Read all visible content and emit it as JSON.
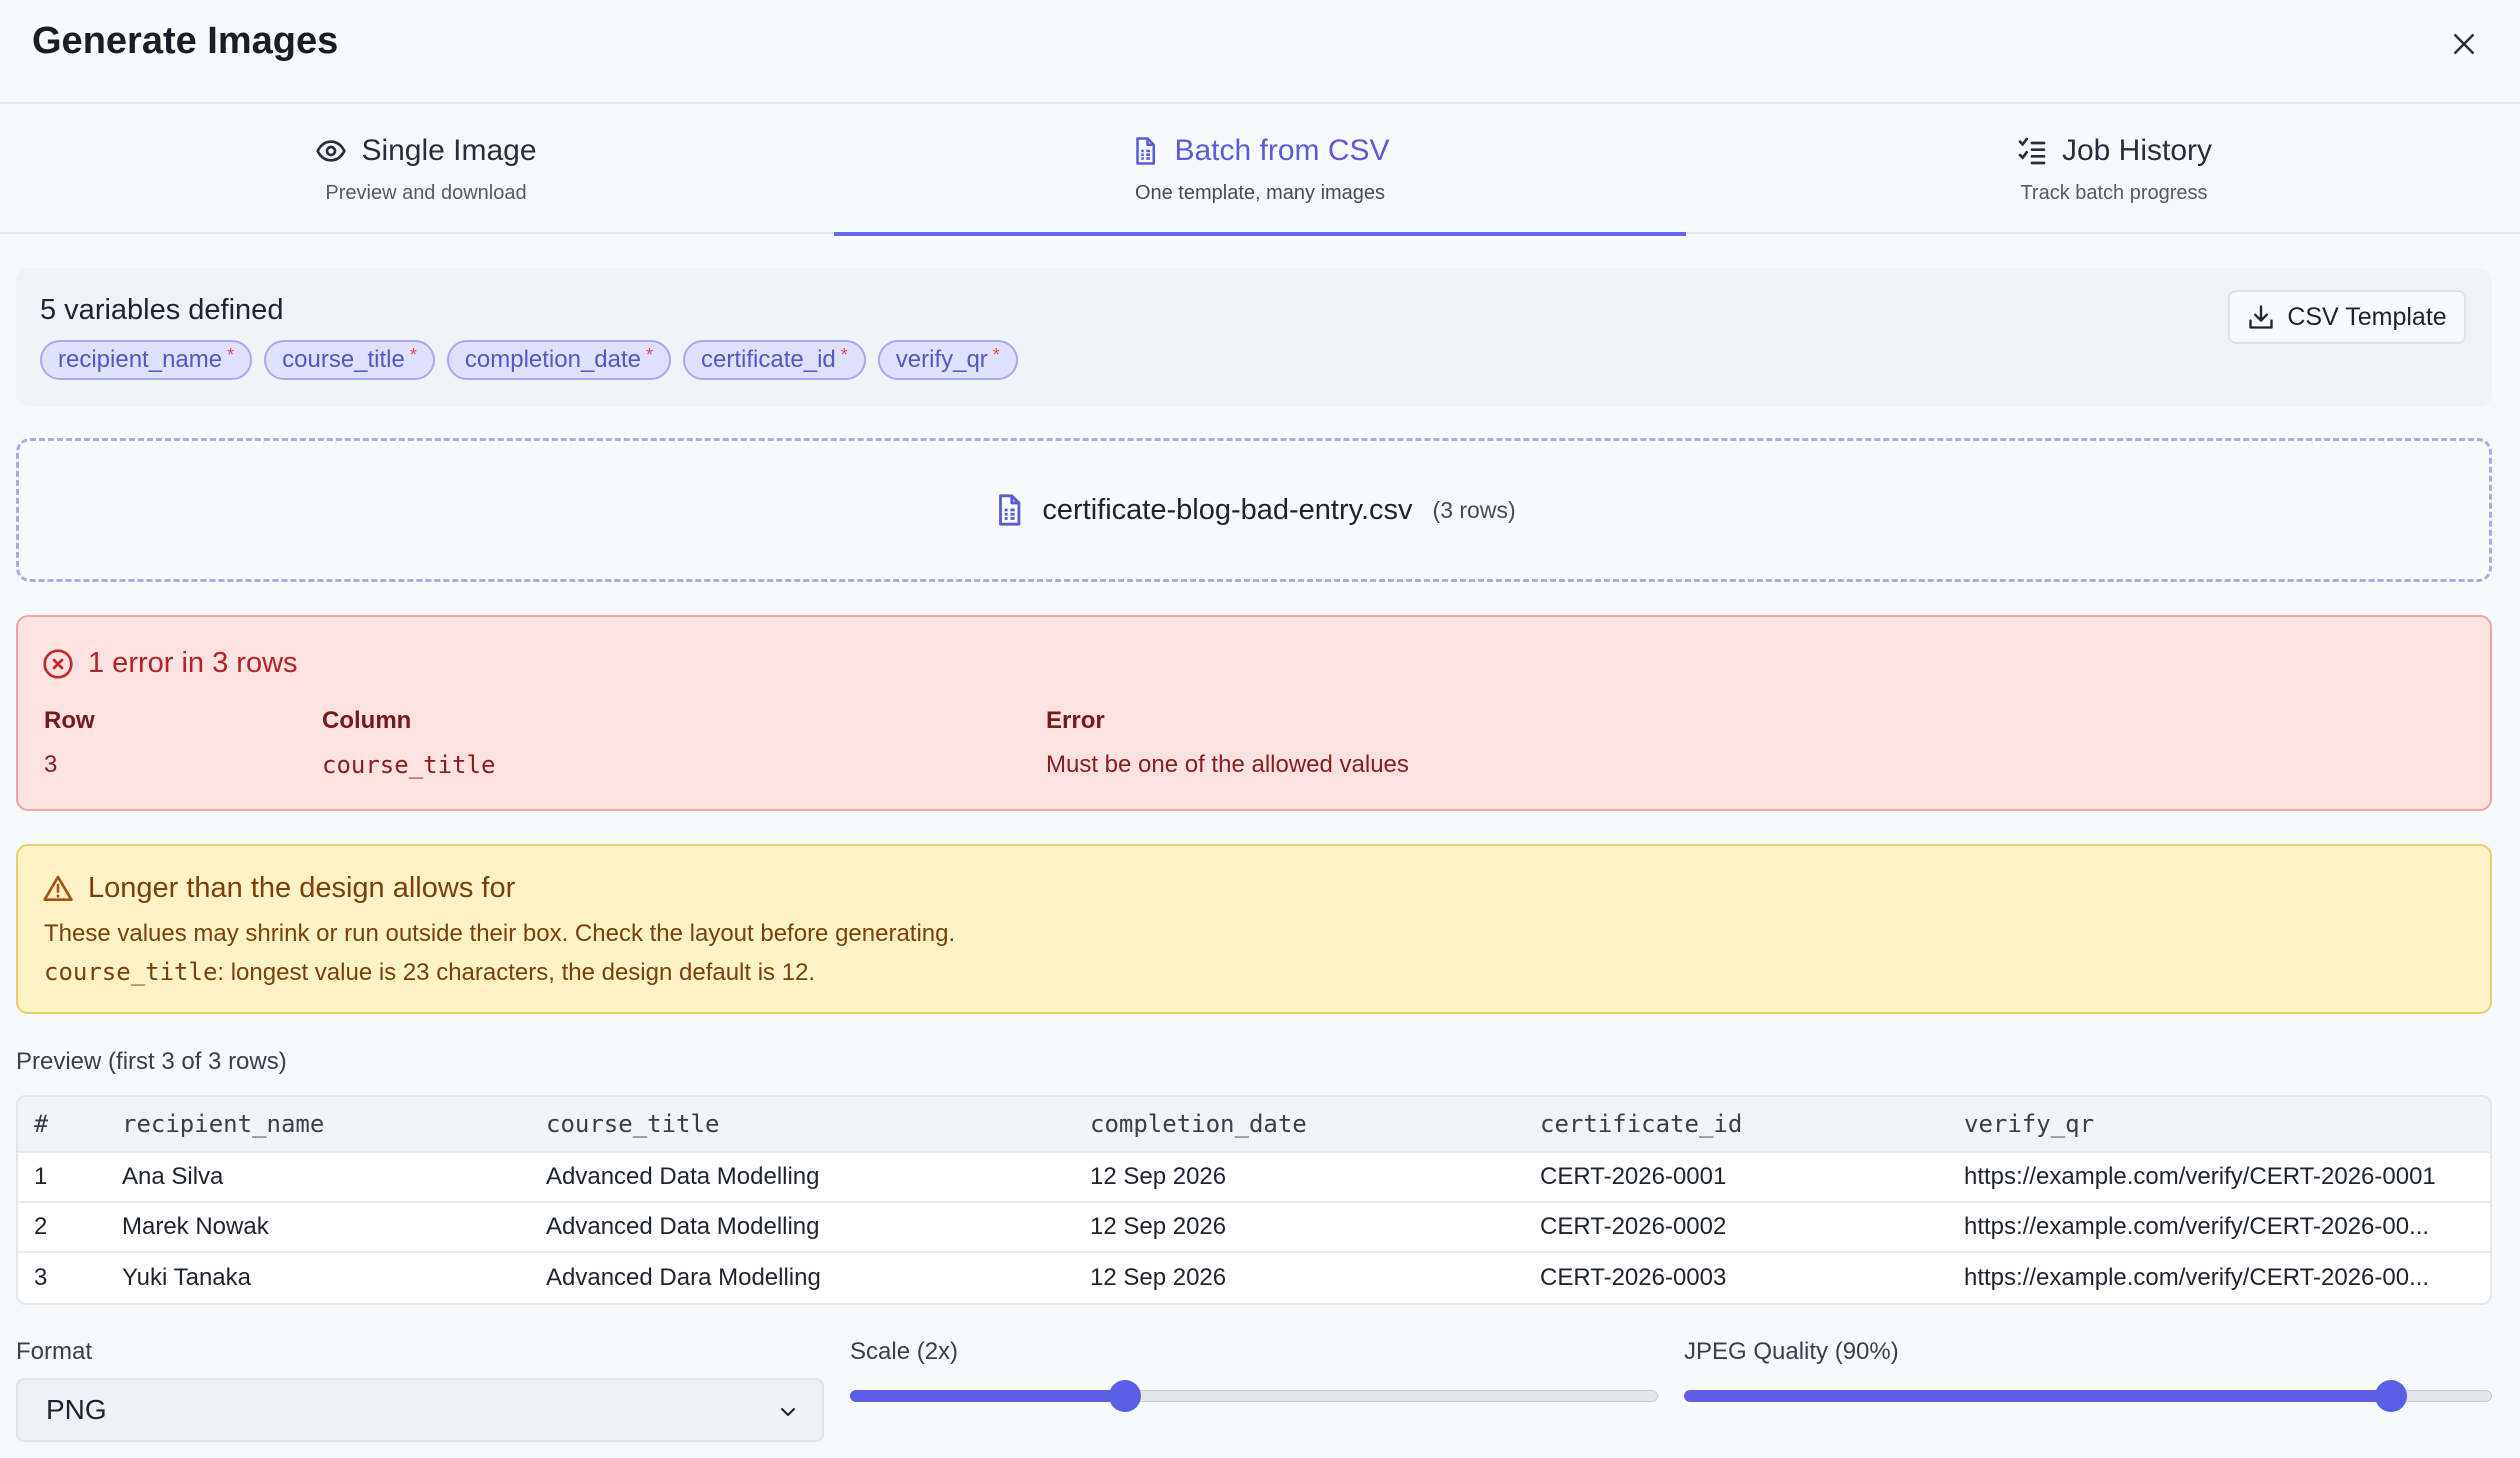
{
  "header": {
    "title": "Generate Images"
  },
  "tabs": [
    {
      "label": "Single Image",
      "sub": "Preview and download",
      "icon": "eye-icon"
    },
    {
      "label": "Batch from CSV",
      "sub": "One template, many images",
      "icon": "file-spreadsheet-icon",
      "active": true
    },
    {
      "label": "Job History",
      "sub": "Track batch progress",
      "icon": "list-checks-icon"
    }
  ],
  "variables": {
    "title": "5 variables defined",
    "chips": [
      "recipient_name",
      "course_title",
      "completion_date",
      "certificate_id",
      "verify_qr"
    ],
    "required_mark": "*",
    "csv_template_label": "CSV Template"
  },
  "upload": {
    "filename": "certificate-blog-bad-entry.csv",
    "rows": "(3 rows)"
  },
  "errors": {
    "title": "1 error in 3 rows",
    "headers": {
      "row": "Row",
      "column": "Column",
      "error": "Error"
    },
    "items": [
      {
        "row": "3",
        "column": "course_title",
        "error": "Must be one of the allowed values"
      }
    ]
  },
  "warning": {
    "title": "Longer than the design allows for",
    "line1": "These values may shrink or run outside their box. Check the layout before generating.",
    "field": "course_title",
    "line2_rest": ": longest value is 23 characters, the design default is 12."
  },
  "preview": {
    "label": "Preview (first 3 of 3 rows)",
    "columns": [
      "#",
      "recipient_name",
      "course_title",
      "completion_date",
      "certificate_id",
      "verify_qr"
    ],
    "rows": [
      [
        "1",
        "Ana Silva",
        "Advanced Data Modelling",
        "12 Sep 2026",
        "CERT-2026-0001",
        "https://example.com/verify/CERT-2026-0001"
      ],
      [
        "2",
        "Marek Nowak",
        "Advanced Data Modelling",
        "12 Sep 2026",
        "CERT-2026-0002",
        "https://example.com/verify/CERT-2026-00..."
      ],
      [
        "3",
        "Yuki Tanaka",
        "Advanced Dara Modelling",
        "12 Sep 2026",
        "CERT-2026-0003",
        "https://example.com/verify/CERT-2026-00..."
      ]
    ]
  },
  "controls": {
    "format_label": "Format",
    "format_value": "PNG",
    "scale_label": "Scale (2x)",
    "scale_fraction": 0.34,
    "quality_label": "JPEG Quality (90%)",
    "quality_fraction": 0.875
  },
  "colors": {
    "accent": "#6366f1",
    "error_bg": "#fde2e2",
    "warning_bg": "#fdf3c4"
  }
}
